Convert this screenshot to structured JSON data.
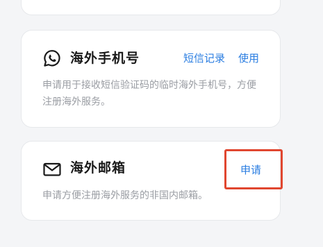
{
  "services": [
    {
      "icon": "whatsapp-phone-icon",
      "title": "海外手机号",
      "description": "申请用于接收短信验证码的临时海外手机号，方便注册海外服务。",
      "actions": [
        "短信记录",
        "使用"
      ]
    },
    {
      "icon": "mail-icon",
      "title": "海外邮箱",
      "description": "申请方便注册海外服务的非国内邮箱。",
      "actions": [
        "申请"
      ]
    }
  ],
  "colors": {
    "accent": "#2a7de1",
    "highlight_border": "#e0462f",
    "background": "#f4f5f7"
  }
}
